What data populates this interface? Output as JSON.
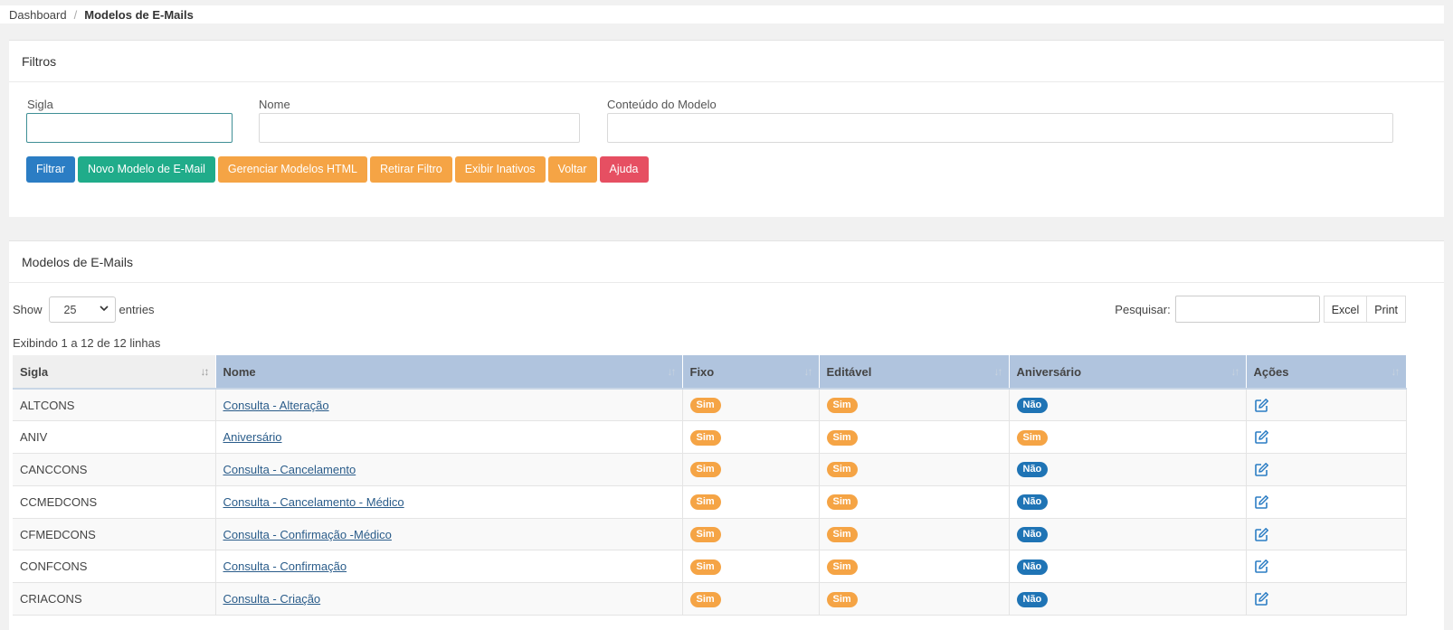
{
  "breadcrumb": {
    "home": "Dashboard",
    "separator": "/",
    "current": "Modelos de E-Mails"
  },
  "filters": {
    "title": "Filtros",
    "sigla_label": "Sigla",
    "sigla_value": "",
    "nome_label": "Nome",
    "nome_value": "",
    "conteudo_label": "Conteúdo do Modelo",
    "conteudo_value": "",
    "buttons": {
      "filtrar": "Filtrar",
      "novo": "Novo Modelo de E-Mail",
      "gerenciar": "Gerenciar Modelos HTML",
      "retirar": "Retirar Filtro",
      "exibir": "Exibir Inativos",
      "voltar": "Voltar",
      "ajuda": "Ajuda"
    }
  },
  "list": {
    "title": "Modelos de E-Mails",
    "show_label": "Show",
    "entries_value": "25",
    "entries_label": "entries",
    "search_label": "Pesquisar:",
    "search_value": "",
    "excel": "Excel",
    "print": "Print",
    "info": "Exibindo 1 a 12 de 12 linhas",
    "columns": [
      "Sigla",
      "Nome",
      "Fixo",
      "Editável",
      "Aniversário",
      "Ações"
    ],
    "rows": [
      {
        "sigla": "ALTCONS",
        "nome": "Consulta - Alteração",
        "fixo": "Sim",
        "editavel": "Sim",
        "aniversario": "Não"
      },
      {
        "sigla": "ANIV",
        "nome": "Aniversário",
        "fixo": "Sim",
        "editavel": "Sim",
        "aniversario": "Sim"
      },
      {
        "sigla": "CANCCONS",
        "nome": "Consulta - Cancelamento",
        "fixo": "Sim",
        "editavel": "Sim",
        "aniversario": "Não"
      },
      {
        "sigla": "CCMEDCONS",
        "nome": "Consulta - Cancelamento - Médico",
        "fixo": "Sim",
        "editavel": "Sim",
        "aniversario": "Não"
      },
      {
        "sigla": "CFMEDCONS",
        "nome": "Consulta - Confirmação -Médico",
        "fixo": "Sim",
        "editavel": "Sim",
        "aniversario": "Não"
      },
      {
        "sigla": "CONFCONS",
        "nome": "Consulta - Confirmação",
        "fixo": "Sim",
        "editavel": "Sim",
        "aniversario": "Não"
      },
      {
        "sigla": "CRIACONS",
        "nome": "Consulta - Criação",
        "fixo": "Sim",
        "editavel": "Sim",
        "aniversario": "Não"
      }
    ]
  },
  "colors": {
    "primary": "#2b7dc4",
    "success": "#20ac8a",
    "warning": "#f5a445",
    "danger": "#e64f62",
    "header_bg": "#b0c4de",
    "badge_nao": "#1f74b5"
  },
  "icons": {
    "edit": "edit-icon",
    "sort": "sort-icon",
    "sort_active": "sort-asc-icon",
    "select": "chevron-down-icon"
  }
}
